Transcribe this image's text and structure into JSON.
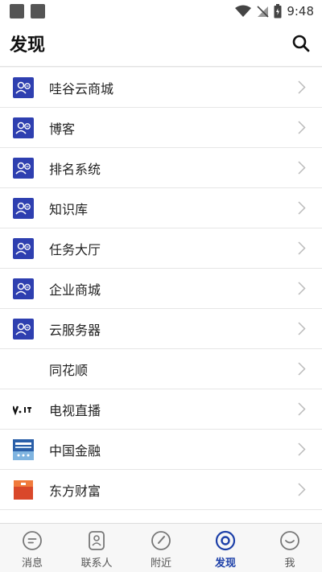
{
  "status": {
    "time": "9:48"
  },
  "header": {
    "title": "发现"
  },
  "items": [
    {
      "label": "哇谷云商城",
      "icon": "contact-card-icon"
    },
    {
      "label": "博客",
      "icon": "contact-card-icon"
    },
    {
      "label": "排名系统",
      "icon": "contact-card-icon"
    },
    {
      "label": "知识库",
      "icon": "contact-card-icon"
    },
    {
      "label": "任务大厅",
      "icon": "contact-card-icon"
    },
    {
      "label": "企业商城",
      "icon": "contact-card-icon"
    },
    {
      "label": "云服务器",
      "icon": "contact-card-icon"
    },
    {
      "label": "同花顺",
      "icon": "none"
    },
    {
      "label": "电视直播",
      "icon": "tv-logo-icon"
    },
    {
      "label": "中国金融",
      "icon": "finance-logo-icon"
    },
    {
      "label": "东方财富",
      "icon": "red-book-icon"
    }
  ],
  "tabs": [
    {
      "label": "消息",
      "icon": "message-icon"
    },
    {
      "label": "联系人",
      "icon": "contacts-icon"
    },
    {
      "label": "附近",
      "icon": "compass-icon"
    },
    {
      "label": "发现",
      "icon": "discover-icon",
      "active": true
    },
    {
      "label": "我",
      "icon": "smile-icon"
    }
  ],
  "colors": {
    "accent": "#1c3fa8",
    "icon_bg": "#2e3fb0"
  }
}
